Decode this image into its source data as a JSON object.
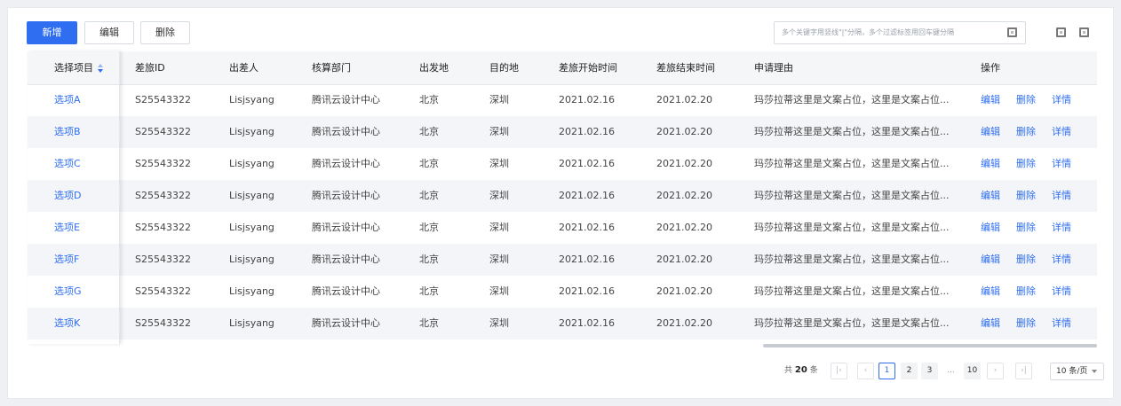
{
  "toolbar": {
    "add_label": "新增",
    "edit_label": "编辑",
    "delete_label": "删除"
  },
  "search": {
    "placeholder": "多个关键字用竖线\"|\"分隔，多个过滤标签用回车键分隔"
  },
  "table": {
    "headers": [
      "选择项目",
      "差旅ID",
      "出差人",
      "核算部门",
      "出发地",
      "目的地",
      "差旅开始时间",
      "差旅结束时间",
      "申请理由",
      "操作"
    ],
    "rows": [
      {
        "item": "选项A",
        "id": "S25543322",
        "traveler": "Lisjsyang",
        "dept": "腾讯云设计中心",
        "from": "北京",
        "to": "深圳",
        "start": "2021.02.16",
        "end": "2021.02.20",
        "reason": "玛莎拉蒂这里是文案占位，这里是文案占位...",
        "edit": "编辑",
        "delete": "删除",
        "detail": "详情"
      },
      {
        "item": "选项B",
        "id": "S25543322",
        "traveler": "Lisjsyang",
        "dept": "腾讯云设计中心",
        "from": "北京",
        "to": "深圳",
        "start": "2021.02.16",
        "end": "2021.02.20",
        "reason": "玛莎拉蒂这里是文案占位，这里是文案占位...",
        "edit": "编辑",
        "delete": "删除",
        "detail": "详情"
      },
      {
        "item": "选项C",
        "id": "S25543322",
        "traveler": "Lisjsyang",
        "dept": "腾讯云设计中心",
        "from": "北京",
        "to": "深圳",
        "start": "2021.02.16",
        "end": "2021.02.20",
        "reason": "玛莎拉蒂这里是文案占位，这里是文案占位...",
        "edit": "编辑",
        "delete": "删除",
        "detail": "详情"
      },
      {
        "item": "选项D",
        "id": "S25543322",
        "traveler": "Lisjsyang",
        "dept": "腾讯云设计中心",
        "from": "北京",
        "to": "深圳",
        "start": "2021.02.16",
        "end": "2021.02.20",
        "reason": "玛莎拉蒂这里是文案占位，这里是文案占位...",
        "edit": "编辑",
        "delete": "删除",
        "detail": "详情"
      },
      {
        "item": "选项E",
        "id": "S25543322",
        "traveler": "Lisjsyang",
        "dept": "腾讯云设计中心",
        "from": "北京",
        "to": "深圳",
        "start": "2021.02.16",
        "end": "2021.02.20",
        "reason": "玛莎拉蒂这里是文案占位，这里是文案占位...",
        "edit": "编辑",
        "delete": "删除",
        "detail": "详情"
      },
      {
        "item": "选项F",
        "id": "S25543322",
        "traveler": "Lisjsyang",
        "dept": "腾讯云设计中心",
        "from": "北京",
        "to": "深圳",
        "start": "2021.02.16",
        "end": "2021.02.20",
        "reason": "玛莎拉蒂这里是文案占位，这里是文案占位...",
        "edit": "编辑",
        "delete": "删除",
        "detail": "详情"
      },
      {
        "item": "选项G",
        "id": "S25543322",
        "traveler": "Lisjsyang",
        "dept": "腾讯云设计中心",
        "from": "北京",
        "to": "深圳",
        "start": "2021.02.16",
        "end": "2021.02.20",
        "reason": "玛莎拉蒂这里是文案占位，这里是文案占位...",
        "edit": "编辑",
        "delete": "删除",
        "detail": "详情"
      },
      {
        "item": "选项K",
        "id": "S25543322",
        "traveler": "Lisjsyang",
        "dept": "腾讯云设计中心",
        "from": "北京",
        "to": "深圳",
        "start": "2021.02.16",
        "end": "2021.02.20",
        "reason": "玛莎拉蒂这里是文案占位，这里是文案占位...",
        "edit": "编辑",
        "delete": "删除",
        "detail": "详情"
      }
    ]
  },
  "pagination": {
    "total_prefix": "共",
    "total": "20",
    "total_suffix": "条",
    "pages": [
      "1",
      "2",
      "3",
      "...",
      "10"
    ],
    "current_page": "1",
    "page_size": "10 条/页"
  },
  "colors": {
    "primary": "#2f6ef0",
    "row_alt": "#f3f5f8",
    "header_bg": "#f5f6f8"
  },
  "icons": [
    "filter-icon",
    "column-settings-icon",
    "fullscreen-icon",
    "sort-icon",
    "first-page-icon",
    "prev-page-icon",
    "next-page-icon",
    "last-page-icon",
    "chevron-down-icon"
  ]
}
